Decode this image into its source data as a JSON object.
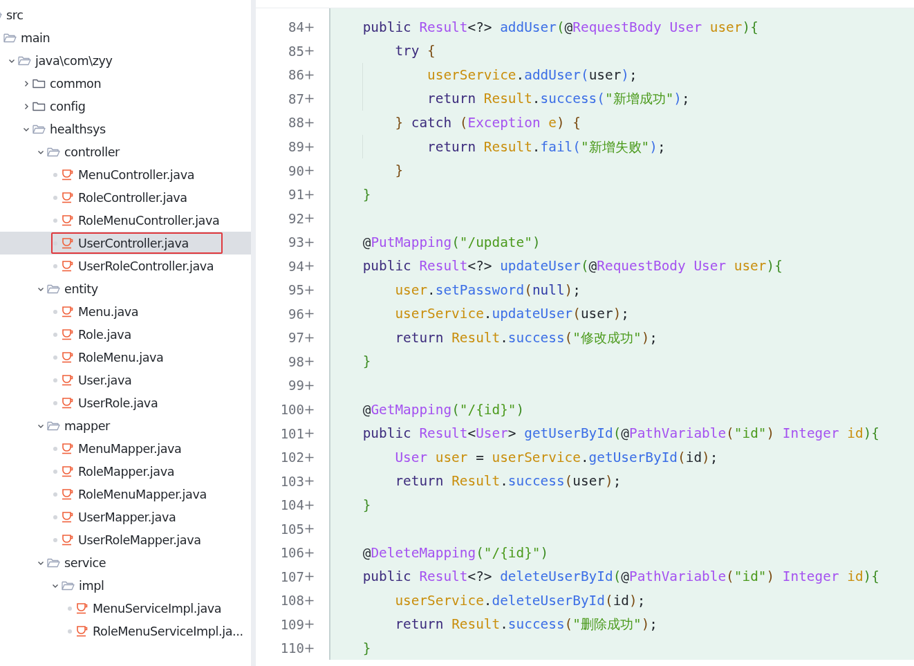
{
  "project_tree": [
    {
      "label": "src",
      "kind": "folder",
      "children": [
        {
          "label": "main",
          "kind": "folder",
          "children": [
            {
              "label": "java\\com\\zyy",
              "kind": "folder",
              "expanded": true,
              "children": [
                {
                  "label": "common",
                  "kind": "folder",
                  "expanded": false
                },
                {
                  "label": "config",
                  "kind": "folder",
                  "expanded": false
                },
                {
                  "label": "healthsys",
                  "kind": "folder",
                  "expanded": true,
                  "children": [
                    {
                      "label": "controller",
                      "kind": "folder",
                      "expanded": true,
                      "children": [
                        {
                          "label": "MenuController.java",
                          "kind": "file",
                          "selected": false
                        },
                        {
                          "label": "RoleController.java",
                          "kind": "file",
                          "selected": false
                        },
                        {
                          "label": "RoleMenuController.java",
                          "kind": "file",
                          "selected": false
                        },
                        {
                          "label": "UserController.java",
                          "kind": "file",
                          "selected": true
                        },
                        {
                          "label": "UserRoleController.java",
                          "kind": "file",
                          "selected": false
                        }
                      ]
                    },
                    {
                      "label": "entity",
                      "kind": "folder",
                      "expanded": true,
                      "children": [
                        {
                          "label": "Menu.java",
                          "kind": "file",
                          "selected": false
                        },
                        {
                          "label": "Role.java",
                          "kind": "file",
                          "selected": false
                        },
                        {
                          "label": "RoleMenu.java",
                          "kind": "file",
                          "selected": false
                        },
                        {
                          "label": "User.java",
                          "kind": "file",
                          "selected": false
                        },
                        {
                          "label": "UserRole.java",
                          "kind": "file",
                          "selected": false
                        }
                      ]
                    },
                    {
                      "label": "mapper",
                      "kind": "folder",
                      "expanded": true,
                      "children": [
                        {
                          "label": "MenuMapper.java",
                          "kind": "file",
                          "selected": false
                        },
                        {
                          "label": "RoleMapper.java",
                          "kind": "file",
                          "selected": false
                        },
                        {
                          "label": "RoleMenuMapper.java",
                          "kind": "file",
                          "selected": false
                        },
                        {
                          "label": "UserMapper.java",
                          "kind": "file",
                          "selected": false
                        },
                        {
                          "label": "UserRoleMapper.java",
                          "kind": "file",
                          "selected": false
                        }
                      ]
                    },
                    {
                      "label": "service",
                      "kind": "folder",
                      "expanded": true,
                      "children": [
                        {
                          "label": "impl",
                          "kind": "folder",
                          "expanded": true,
                          "children": [
                            {
                              "label": "MenuServiceImpl.java",
                              "kind": "file",
                              "selected": false
                            },
                            {
                              "label": "RoleMenuServiceImpl.ja...",
                              "kind": "file",
                              "selected": false
                            }
                          ]
                        }
                      ]
                    }
                  ]
                }
              ]
            }
          ]
        }
      ]
    }
  ],
  "editor": {
    "lines": [
      {
        "number": "84",
        "added": true,
        "tokens": [
          {
            "text": "    public ",
            "kind": "keyword"
          },
          {
            "text": "Result",
            "kind": "type"
          },
          {
            "text": "<?> ",
            "kind": "plain"
          },
          {
            "text": "addUser",
            "kind": "method"
          },
          {
            "text": "(",
            "kind": "brace1"
          },
          {
            "text": "@",
            "kind": "plain"
          },
          {
            "text": "RequestBody ",
            "kind": "type"
          },
          {
            "text": "User ",
            "kind": "type"
          },
          {
            "text": "user",
            "kind": "field"
          },
          {
            "text": "){",
            "kind": "brace1"
          }
        ]
      },
      {
        "number": "85",
        "added": true,
        "tokens": [
          {
            "text": "        try ",
            "kind": "keyword"
          },
          {
            "text": "{",
            "kind": "brace2"
          }
        ]
      },
      {
        "number": "86",
        "added": true,
        "tokens": [
          {
            "text": "            userService",
            "kind": "field"
          },
          {
            "text": ".",
            "kind": "plain"
          },
          {
            "text": "addUser",
            "kind": "method"
          },
          {
            "text": "(",
            "kind": "brace3"
          },
          {
            "text": "user",
            "kind": "plain"
          },
          {
            "text": ")",
            "kind": "brace3"
          },
          {
            "text": ";",
            "kind": "plain"
          }
        ]
      },
      {
        "number": "87",
        "added": true,
        "tokens": [
          {
            "text": "            return ",
            "kind": "keyword"
          },
          {
            "text": "Result",
            "kind": "field"
          },
          {
            "text": ".",
            "kind": "plain"
          },
          {
            "text": "success",
            "kind": "method"
          },
          {
            "text": "(",
            "kind": "brace3"
          },
          {
            "text": "\"新增成功\"",
            "kind": "string"
          },
          {
            "text": ")",
            "kind": "brace3"
          },
          {
            "text": ";",
            "kind": "plain"
          }
        ]
      },
      {
        "number": "88",
        "added": true,
        "tokens": [
          {
            "text": "        } ",
            "kind": "brace2"
          },
          {
            "text": "catch ",
            "kind": "keyword"
          },
          {
            "text": "(",
            "kind": "brace2"
          },
          {
            "text": "Exception ",
            "kind": "type"
          },
          {
            "text": "e",
            "kind": "field"
          },
          {
            "text": ") {",
            "kind": "brace2"
          }
        ]
      },
      {
        "number": "89",
        "added": true,
        "tokens": [
          {
            "text": "            return ",
            "kind": "keyword"
          },
          {
            "text": "Result",
            "kind": "field"
          },
          {
            "text": ".",
            "kind": "plain"
          },
          {
            "text": "fail",
            "kind": "method"
          },
          {
            "text": "(",
            "kind": "brace3"
          },
          {
            "text": "\"新增失败\"",
            "kind": "string"
          },
          {
            "text": ")",
            "kind": "brace3"
          },
          {
            "text": ";",
            "kind": "plain"
          }
        ]
      },
      {
        "number": "90",
        "added": true,
        "tokens": [
          {
            "text": "        }",
            "kind": "brace2"
          }
        ]
      },
      {
        "number": "91",
        "added": true,
        "tokens": [
          {
            "text": "    }",
            "kind": "brace1"
          }
        ]
      },
      {
        "number": "92",
        "added": true
      },
      {
        "number": "93",
        "added": true,
        "tokens": [
          {
            "text": "    @",
            "kind": "plain"
          },
          {
            "text": "PutMapping",
            "kind": "type"
          },
          {
            "text": "(",
            "kind": "brace1"
          },
          {
            "text": "\"/update\"",
            "kind": "string"
          },
          {
            "text": ")",
            "kind": "brace1"
          }
        ]
      },
      {
        "number": "94",
        "added": true,
        "tokens": [
          {
            "text": "    public ",
            "kind": "keyword"
          },
          {
            "text": "Result",
            "kind": "type"
          },
          {
            "text": "<?> ",
            "kind": "plain"
          },
          {
            "text": "updateUser",
            "kind": "method"
          },
          {
            "text": "(",
            "kind": "brace1"
          },
          {
            "text": "@",
            "kind": "plain"
          },
          {
            "text": "RequestBody ",
            "kind": "type"
          },
          {
            "text": "User ",
            "kind": "type"
          },
          {
            "text": "user",
            "kind": "field"
          },
          {
            "text": "){",
            "kind": "brace1"
          }
        ]
      },
      {
        "number": "95",
        "added": true,
        "tokens": [
          {
            "text": "        user",
            "kind": "field"
          },
          {
            "text": ".",
            "kind": "plain"
          },
          {
            "text": "setPassword",
            "kind": "method"
          },
          {
            "text": "(",
            "kind": "brace2"
          },
          {
            "text": "null",
            "kind": "keyword2"
          },
          {
            "text": ")",
            "kind": "brace2"
          },
          {
            "text": ";",
            "kind": "plain"
          }
        ]
      },
      {
        "number": "96",
        "added": true,
        "tokens": [
          {
            "text": "        userService",
            "kind": "field"
          },
          {
            "text": ".",
            "kind": "plain"
          },
          {
            "text": "updateUser",
            "kind": "method"
          },
          {
            "text": "(",
            "kind": "brace2"
          },
          {
            "text": "user",
            "kind": "plain"
          },
          {
            "text": ")",
            "kind": "brace2"
          },
          {
            "text": ";",
            "kind": "plain"
          }
        ]
      },
      {
        "number": "97",
        "added": true,
        "tokens": [
          {
            "text": "        return ",
            "kind": "keyword"
          },
          {
            "text": "Result",
            "kind": "field"
          },
          {
            "text": ".",
            "kind": "plain"
          },
          {
            "text": "success",
            "kind": "method"
          },
          {
            "text": "(",
            "kind": "brace2"
          },
          {
            "text": "\"修改成功\"",
            "kind": "string"
          },
          {
            "text": ")",
            "kind": "brace2"
          },
          {
            "text": ";",
            "kind": "plain"
          }
        ]
      },
      {
        "number": "98",
        "added": true,
        "tokens": [
          {
            "text": "    }",
            "kind": "brace1"
          }
        ]
      },
      {
        "number": "99",
        "added": true
      },
      {
        "number": "100",
        "added": true,
        "tokens": [
          {
            "text": "    @",
            "kind": "plain"
          },
          {
            "text": "GetMapping",
            "kind": "type"
          },
          {
            "text": "(",
            "kind": "brace1"
          },
          {
            "text": "\"/{id}\"",
            "kind": "string"
          },
          {
            "text": ")",
            "kind": "brace1"
          }
        ]
      },
      {
        "number": "101",
        "added": true,
        "tokens": [
          {
            "text": "    public ",
            "kind": "keyword"
          },
          {
            "text": "Result",
            "kind": "type"
          },
          {
            "text": "<",
            "kind": "plain"
          },
          {
            "text": "User",
            "kind": "type"
          },
          {
            "text": "> ",
            "kind": "plain"
          },
          {
            "text": "getUserById",
            "kind": "method"
          },
          {
            "text": "(",
            "kind": "brace1"
          },
          {
            "text": "@",
            "kind": "plain"
          },
          {
            "text": "PathVariable",
            "kind": "type"
          },
          {
            "text": "(",
            "kind": "brace2"
          },
          {
            "text": "\"id\"",
            "kind": "string"
          },
          {
            "text": ") ",
            "kind": "brace2"
          },
          {
            "text": "Integer ",
            "kind": "type"
          },
          {
            "text": "id",
            "kind": "field"
          },
          {
            "text": "){",
            "kind": "brace1"
          }
        ]
      },
      {
        "number": "102",
        "added": true,
        "tokens": [
          {
            "text": "        User ",
            "kind": "type"
          },
          {
            "text": "user ",
            "kind": "field"
          },
          {
            "text": "= ",
            "kind": "plain"
          },
          {
            "text": "userService",
            "kind": "field"
          },
          {
            "text": ".",
            "kind": "plain"
          },
          {
            "text": "getUserById",
            "kind": "method"
          },
          {
            "text": "(",
            "kind": "brace2"
          },
          {
            "text": "id",
            "kind": "plain"
          },
          {
            "text": ")",
            "kind": "brace2"
          },
          {
            "text": ";",
            "kind": "plain"
          }
        ]
      },
      {
        "number": "103",
        "added": true,
        "tokens": [
          {
            "text": "        return ",
            "kind": "keyword"
          },
          {
            "text": "Result",
            "kind": "field"
          },
          {
            "text": ".",
            "kind": "plain"
          },
          {
            "text": "success",
            "kind": "method"
          },
          {
            "text": "(",
            "kind": "brace2"
          },
          {
            "text": "user",
            "kind": "plain"
          },
          {
            "text": ")",
            "kind": "brace2"
          },
          {
            "text": ";",
            "kind": "plain"
          }
        ]
      },
      {
        "number": "104",
        "added": true,
        "tokens": [
          {
            "text": "    }",
            "kind": "brace1"
          }
        ]
      },
      {
        "number": "105",
        "added": true
      },
      {
        "number": "106",
        "added": true,
        "tokens": [
          {
            "text": "    @",
            "kind": "plain"
          },
          {
            "text": "DeleteMapping",
            "kind": "type"
          },
          {
            "text": "(",
            "kind": "brace1"
          },
          {
            "text": "\"/{id}\"",
            "kind": "string"
          },
          {
            "text": ")",
            "kind": "brace1"
          }
        ]
      },
      {
        "number": "107",
        "added": true,
        "tokens": [
          {
            "text": "    public ",
            "kind": "keyword"
          },
          {
            "text": "Result",
            "kind": "type"
          },
          {
            "text": "<?> ",
            "kind": "plain"
          },
          {
            "text": "deleteUserById",
            "kind": "method"
          },
          {
            "text": "(",
            "kind": "brace1"
          },
          {
            "text": "@",
            "kind": "plain"
          },
          {
            "text": "PathVariable",
            "kind": "type"
          },
          {
            "text": "(",
            "kind": "brace2"
          },
          {
            "text": "\"id\"",
            "kind": "string"
          },
          {
            "text": ") ",
            "kind": "brace2"
          },
          {
            "text": "Integer ",
            "kind": "type"
          },
          {
            "text": "id",
            "kind": "field"
          },
          {
            "text": "){",
            "kind": "brace1"
          }
        ]
      },
      {
        "number": "108",
        "added": true,
        "tokens": [
          {
            "text": "        userService",
            "kind": "field"
          },
          {
            "text": ".",
            "kind": "plain"
          },
          {
            "text": "deleteUserById",
            "kind": "method"
          },
          {
            "text": "(",
            "kind": "brace2"
          },
          {
            "text": "id",
            "kind": "plain"
          },
          {
            "text": ")",
            "kind": "brace2"
          },
          {
            "text": ";",
            "kind": "plain"
          }
        ]
      },
      {
        "number": "109",
        "added": true,
        "tokens": [
          {
            "text": "        return ",
            "kind": "keyword"
          },
          {
            "text": "Result",
            "kind": "field"
          },
          {
            "text": ".",
            "kind": "plain"
          },
          {
            "text": "success",
            "kind": "method"
          },
          {
            "text": "(",
            "kind": "brace2"
          },
          {
            "text": "\"删除成功\"",
            "kind": "string"
          },
          {
            "text": ")",
            "kind": "brace2"
          },
          {
            "text": ";",
            "kind": "plain"
          }
        ]
      },
      {
        "number": "110",
        "added": true,
        "tokens": [
          {
            "text": "    }",
            "kind": "brace1"
          }
        ]
      }
    ]
  }
}
